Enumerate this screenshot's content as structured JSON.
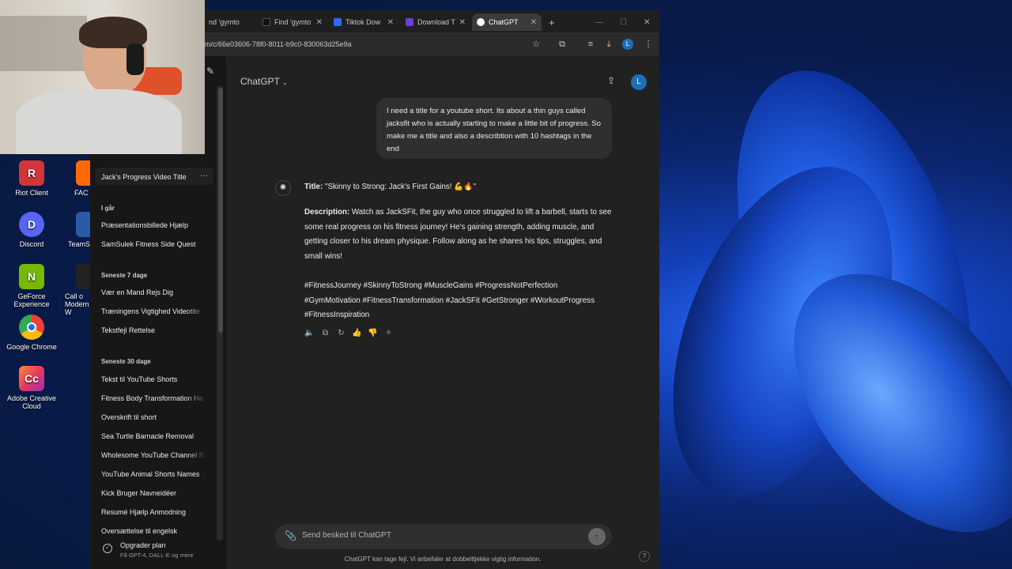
{
  "desktop": {
    "icons": [
      {
        "label": "Riot Client",
        "color": "#d13639",
        "glyph": "R"
      },
      {
        "label": "Discord",
        "color": "#5865f2",
        "glyph": "D"
      },
      {
        "label": "GeForce Experience",
        "color": "#76b900",
        "glyph": "N"
      },
      {
        "label": "Google Chrome",
        "color": "#1a73e8",
        "glyph": "●"
      },
      {
        "label": "Adobe Creative Cloud",
        "color": "#e8395c",
        "glyph": "Cc"
      }
    ],
    "partial_icons": [
      {
        "label": "FAC",
        "color": "#ff6a00"
      },
      {
        "label": "TeamSp",
        "color": "#2b5aa8"
      },
      {
        "label": "Call o Modern W",
        "color": "#222222"
      }
    ]
  },
  "browser": {
    "tabs": [
      {
        "label": "nd 'gymto",
        "active": false,
        "color": "#555"
      },
      {
        "label": "Find 'gymto",
        "active": false,
        "color": "#111"
      },
      {
        "label": "Tiktok Dow",
        "active": false,
        "color": "#2b6cff"
      },
      {
        "label": "Download T",
        "active": false,
        "color": "#6b3fd8"
      },
      {
        "label": "ChatGPT",
        "active": true,
        "color": "#ffffff"
      }
    ],
    "url": "om/c/66e03606-78f0-8011-b9c0-830063d25e9a",
    "profile_initial": "L"
  },
  "sidebar": {
    "current_chat": "Jack's Progress Video Title",
    "groups": [
      {
        "heading": "I går",
        "items": [
          "Præsentationsbillede Hjælp",
          "SamSulek Fitness Side Quest"
        ]
      },
      {
        "heading": "Seneste 7 dage",
        "items": [
          "Vær en Mand Rejs Dig",
          "Træningens Vigtighed Videotite",
          "Tekstfejl Rettelse"
        ]
      },
      {
        "heading": "Seneste 30 dage",
        "items": [
          "Tekst til YouTube Shorts",
          "Fitness Body Transformation Ha",
          "Overskrift til short",
          "Sea Turtle Barnacle Removal",
          "Wholesome YouTube Channel N",
          "YouTube Animal Shorts Names",
          "Kick Bruger Navneidéer",
          "Resumé Hjælp Anmodning",
          "Oversættelse til engelsk"
        ]
      }
    ],
    "upgrade_title": "Opgrader plan",
    "upgrade_subtitle": "Få GPT-4, DALL-E og mere"
  },
  "chat": {
    "model": "ChatGPT",
    "user_initial": "L",
    "user_message": "I need a title for a youtube short. Its about a thin guys called jacksfit who is actually starting to make a little bit of progress. So make me a title and also a describtion with 10 hashtags in the end",
    "title_label": "Title:",
    "title_text": "\"Skinny to Strong: Jack's First Gains! 💪🔥\"",
    "description_label": "Description:",
    "description_text": "Watch as JackSFit, the guy who once struggled to lift a barbell, starts to see some real progress on his fitness journey! He's gaining strength, adding muscle, and getting closer to his dream physique. Follow along as he shares his tips, struggles, and small wins!",
    "hashtags": "#FitnessJourney #SkinnyToStrong #MuscleGains #ProgressNotPerfection #GymMotivation #FitnessTransformation #JackSFit #GetStronger #WorkoutProgress #FitnessInspiration",
    "composer_placeholder": "Send besked til ChatGPT",
    "footer_note": "ChatGPT kan tage fejl. Vi anbefaler at dobbelttjekke vigtig information.",
    "help": "?"
  }
}
